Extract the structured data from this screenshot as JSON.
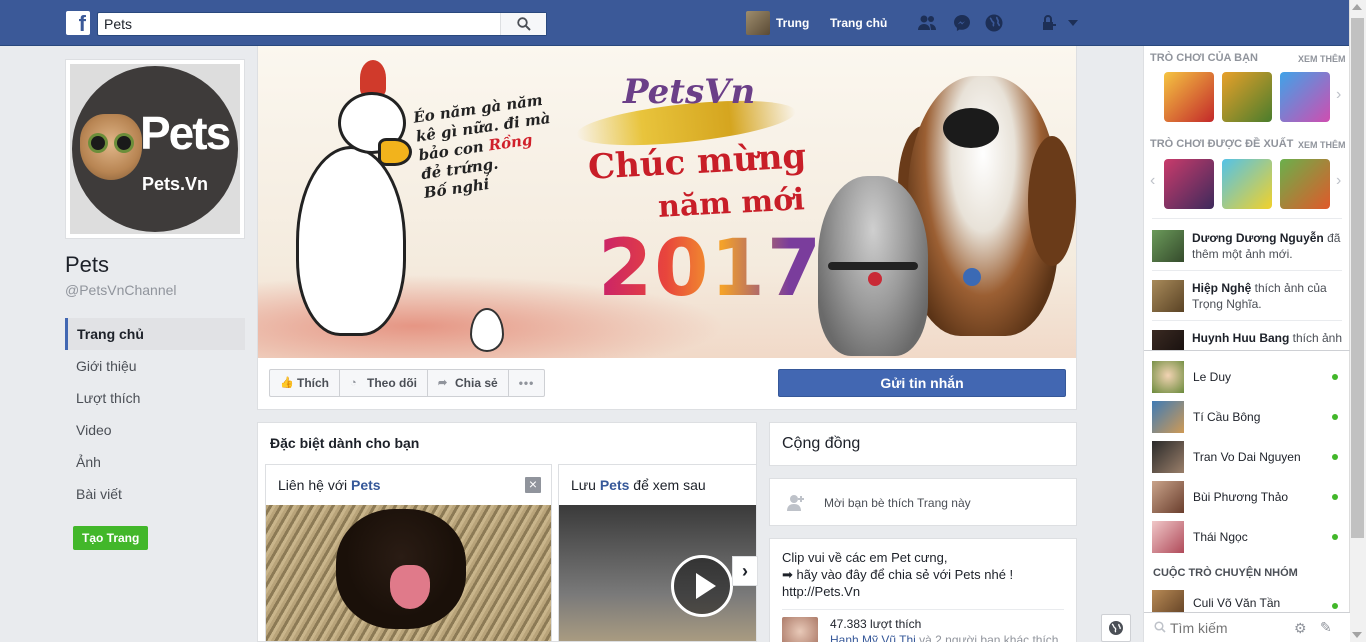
{
  "topbar": {
    "logo": "f",
    "search_value": "Pets",
    "user_name": "Trung",
    "home_label": "Trang chủ"
  },
  "page": {
    "logo_text": "Pets",
    "logo_subtext": "Pets.Vn",
    "name": "Pets",
    "handle": "@PetsVnChannel"
  },
  "leftnav": {
    "items": [
      {
        "label": "Trang chủ"
      },
      {
        "label": "Giới thiệu"
      },
      {
        "label": "Lượt thích"
      },
      {
        "label": "Video"
      },
      {
        "label": "Ảnh"
      },
      {
        "label": "Bài viết"
      }
    ],
    "create_page": "Tạo Trang"
  },
  "cover": {
    "speech": [
      "Éo năm gà năm",
      "kê gì nữa. đi mà",
      "bảo con",
      "Rồng",
      "đẻ trứng.",
      "Bố nghỉ"
    ],
    "brand": "PetsVn",
    "greeting_1": "Chúc mừng",
    "greeting_2": "năm mới",
    "year": "2017"
  },
  "actions": {
    "like": "Thích",
    "follow": "Theo dõi",
    "share": "Chia sẻ",
    "more": "•••",
    "message": "Gửi tin nhắn"
  },
  "special": {
    "title": "Đặc biệt dành cho bạn",
    "card1_prefix": "Liên hệ với ",
    "card1_bold": "Pets",
    "card2_prefix": "Lưu ",
    "card2_bold": "Pets",
    "card2_suffix": " để xem sau"
  },
  "community": {
    "title": "Cộng đồng",
    "invite": "Mời bạn bè thích Trang này"
  },
  "about": {
    "line1": "Clip vui về các em Pet cưng,",
    "line2": "➡ hãy vào đây để chia sẻ với Pets nhé !",
    "line3": "http://Pets.Vn",
    "likes": "47.383 lượt thích",
    "friends_name": "Hạnh Mỹ Vũ Thị",
    "friends_rest": " và 2 người bạn khác thích"
  },
  "sidebar": {
    "your_games": "Trò chơi của bạn",
    "see_more": "Xem thêm",
    "suggested_games": "Trò chơi được đề xuất",
    "see_more_2": "Xem thêm",
    "ticker": [
      {
        "name": "Dương Dương Nguyễn",
        "text": " đã thêm một ảnh mới."
      },
      {
        "name": "Hiệp Nghệ",
        "text": " thích ảnh của Trọng Nghĩa."
      },
      {
        "name": "Huynh Huu Bang",
        "text": " thích ảnh"
      }
    ],
    "contacts": [
      {
        "name": "Le Duy"
      },
      {
        "name": "Tí Cầu Bông"
      },
      {
        "name": "Tran Vo Dai Nguyen"
      },
      {
        "name": "Bùi Phương Thảo"
      },
      {
        "name": "Thái Ngọc"
      }
    ],
    "group_chats": "Cuộc trò chuyện nhóm",
    "group_contact": "Culi Võ Văn Tần",
    "search_placeholder": "Tìm kiếm"
  },
  "colors": {
    "brand_blue": "#3b5998",
    "button_blue": "#4267b2",
    "green": "#42b72a",
    "bg": "#e9ebee"
  }
}
